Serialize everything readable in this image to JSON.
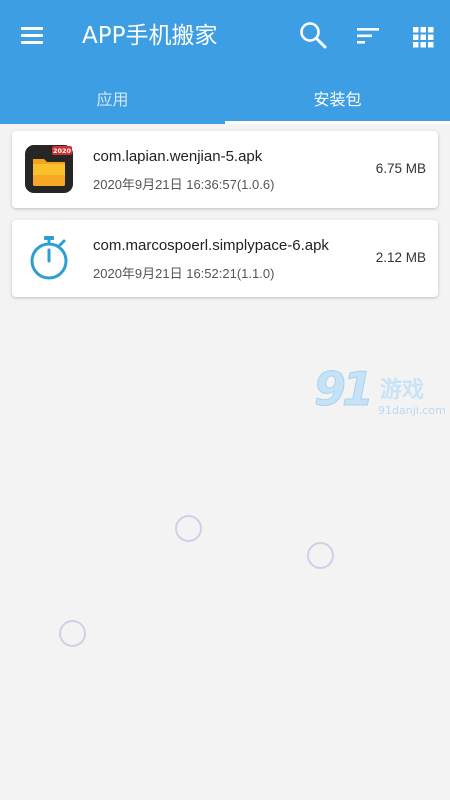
{
  "toolbar": {
    "title": "APP手机搬家",
    "icons": {
      "menu": "menu-icon",
      "search": "search-icon",
      "sort": "sort-icon",
      "view": "grid-view-icon"
    }
  },
  "tabs": [
    {
      "label": "应用",
      "active": false
    },
    {
      "label": "安装包",
      "active": true
    }
  ],
  "packages": [
    {
      "name": "com.lapian.wenjian-5.apk",
      "subtitle": "2020年9月21日 16:36:57(1.0.6)",
      "size": "6.75 MB",
      "icon": "folder-app-icon",
      "icon_badge": "2020"
    },
    {
      "name": "com.marcospoerl.simplypace-6.apk",
      "subtitle": "2020年9月21日 16:52:21(1.1.0)",
      "size": "2.12 MB",
      "icon": "stopwatch-icon"
    }
  ],
  "watermark": {
    "logo": "91",
    "text": "游戏",
    "domain": "91danji.com"
  },
  "colors": {
    "primary": "#3d9ee3",
    "background": "#f3f3f3",
    "card": "#ffffff",
    "stopwatch": "#2a9fd6"
  }
}
